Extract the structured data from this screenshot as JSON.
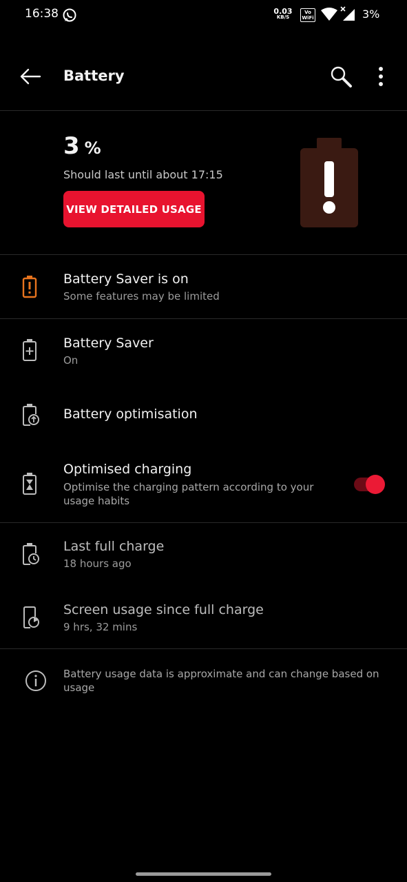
{
  "status_bar": {
    "time": "16:38",
    "net_speed_value": "0.03",
    "net_speed_unit": "KB/S",
    "vowifi_top": "Vo",
    "vowifi_bottom": "WiFi",
    "battery_percent": "3%",
    "icons": [
      "whatsapp-icon",
      "vowifi-icon",
      "wifi-icon",
      "signal-icon"
    ]
  },
  "app_bar": {
    "title": "Battery",
    "icons": [
      "back-arrow-icon",
      "search-icon",
      "more-vert-icon"
    ]
  },
  "header": {
    "percent_value": "3",
    "percent_unit": "%",
    "estimate": "Should last until about 17:15",
    "button_label": "VIEW DETAILED USAGE",
    "battery_graphic": "battery-alert-icon",
    "accent_color": "#e8132f"
  },
  "items": [
    {
      "icon": "battery-alert-icon",
      "title": "Battery Saver is on",
      "subtitle": "Some features may be limited",
      "icon_color": "#e8741e"
    },
    {
      "icon": "battery-plus-icon",
      "title": "Battery Saver",
      "subtitle": "On"
    },
    {
      "icon": "battery-optimise-icon",
      "title": "Battery optimisation",
      "subtitle": ""
    },
    {
      "icon": "battery-hourglass-icon",
      "title": "Optimised charging",
      "subtitle": "Optimise the charging pattern according to your usage habits",
      "toggle": "on"
    },
    {
      "icon": "battery-clock-icon",
      "title": "Last full charge",
      "subtitle": "18 hours ago"
    },
    {
      "icon": "screen-usage-icon",
      "title": "Screen usage since full charge",
      "subtitle": "9 hrs, 32 mins"
    }
  ],
  "footer_note": {
    "icon": "info-icon",
    "text": "Battery usage data is approximate and can change based on usage"
  }
}
